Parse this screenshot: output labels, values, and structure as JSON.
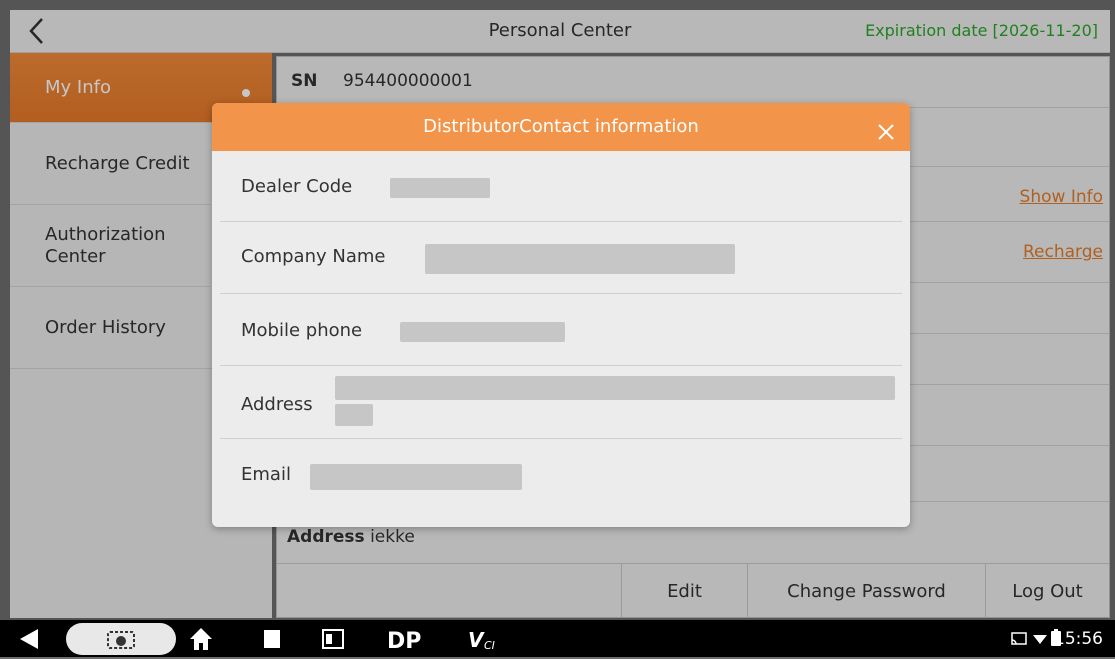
{
  "topbar": {
    "title": "Personal Center",
    "expiration": "Expiration date [2026-11-20]"
  },
  "sidebar": {
    "items": [
      {
        "label": "My Info",
        "active": true
      },
      {
        "label": "Recharge Credit"
      },
      {
        "label": "Authorization Center"
      },
      {
        "label": "Order History"
      }
    ]
  },
  "main": {
    "sn_label": "SN",
    "sn_value": "954400000001",
    "show_info": "Show Info",
    "recharge": "Recharge",
    "address_label": "Address",
    "address_value": "iekke"
  },
  "bottom_bar": {
    "edit": "Edit",
    "change_password": "Change Password",
    "log_out": "Log Out"
  },
  "dialog": {
    "title": "DistributorContact information",
    "fields": {
      "dealer_code": "Dealer Code",
      "company_name": "Company Name",
      "mobile_phone": "Mobile phone",
      "address": "Address",
      "email": "Email"
    }
  },
  "status": {
    "time": "15:56"
  },
  "colors": {
    "accent": "#f2954a",
    "expiry_green": "#2aa52a",
    "link_orange": "#e27b2a"
  },
  "icons": [
    "back-icon",
    "close-icon",
    "nav-back-icon",
    "screenshot-icon",
    "home-icon",
    "recents-icon",
    "app-icon",
    "dp-icon",
    "vci-icon",
    "cast-icon",
    "wifi-icon",
    "battery-icon"
  ]
}
